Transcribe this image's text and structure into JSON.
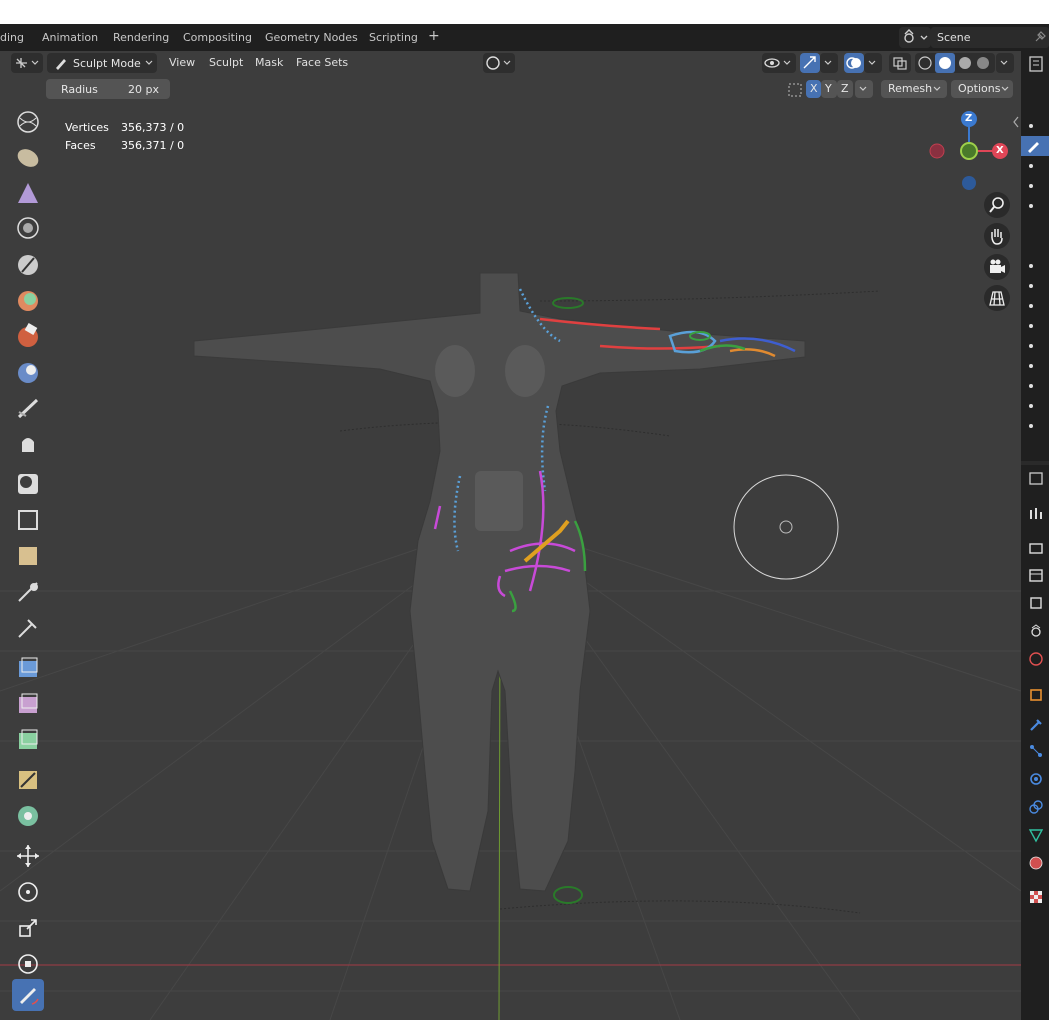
{
  "workspace_tabs": [
    "ding",
    "Animation",
    "Rendering",
    "Compositing",
    "Geometry Nodes",
    "Scripting"
  ],
  "add_tab_glyph": "+",
  "scene": {
    "name": "Scene"
  },
  "viewport_header": {
    "mode_label": "Sculpt Mode",
    "menus": [
      "View",
      "Sculpt",
      "Mask",
      "Face Sets"
    ],
    "radius_label": "Radius",
    "radius_value": "20 px",
    "axis_buttons": [
      "X",
      "Y",
      "Z"
    ],
    "remesh_label": "Remesh",
    "options_label": "Options"
  },
  "stats": {
    "vertices_label": "Vertices",
    "vertices_value": "356,373 / 0",
    "faces_label": "Faces",
    "faces_value": "356,371 / 0"
  },
  "gizmo": {
    "z_label": "Z",
    "x_label": "X"
  },
  "colors": {
    "viewport_bg": "#3d3d3d",
    "active_blue": "#4772b3",
    "axis_red": "#e04657",
    "axis_green": "#7dba3b",
    "axis_blue": "#3b7ad0"
  },
  "toolbar_icons": [
    "draw-brush-icon",
    "clay-strips-icon",
    "inflate-icon",
    "blob-icon",
    "crease-icon",
    "smooth-icon",
    "flatten-icon",
    "fill-icon",
    "scrape-icon",
    "pinch-icon",
    "mask-icon",
    "box-mask-icon",
    "lasso-mask-icon",
    "line-mask-icon",
    "face-set-icon",
    "box-face-set-icon",
    "lasso-face-set-icon",
    "trim-icon",
    "annotate-face-icon",
    "mesh-filter-icon",
    "move-icon",
    "rotate-icon",
    "scale-icon",
    "transform-icon",
    "annotate-icon"
  ],
  "properties_icons": [
    "tool-icon",
    "render-icon",
    "output-icon",
    "view-layer-icon",
    "scene-icon",
    "world-icon",
    "object-icon",
    "modifier-icon",
    "particles-icon",
    "physics-icon",
    "constraints-icon",
    "data-icon",
    "material-icon",
    "texture-icon"
  ]
}
